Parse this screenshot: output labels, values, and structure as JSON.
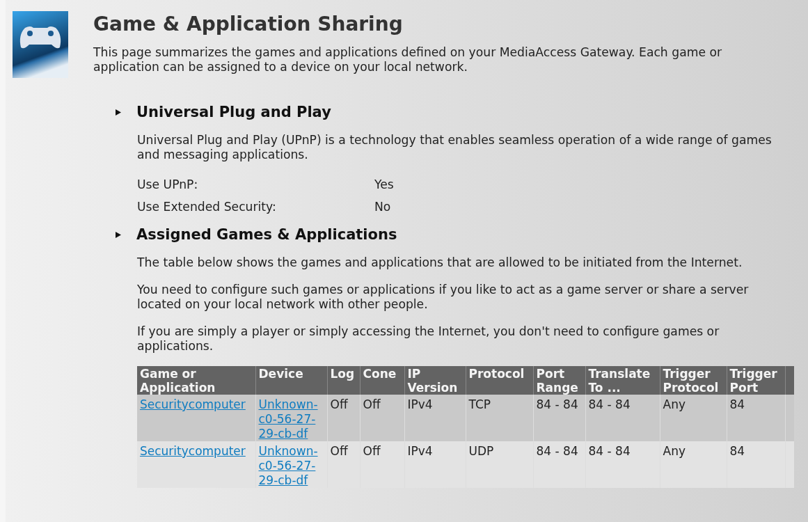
{
  "header": {
    "title": "Game & Application Sharing",
    "description": "This page summarizes the games and applications defined on your MediaAccess Gateway. Each game or application can be assigned to a device on your local network."
  },
  "sections": [
    {
      "title": "Universal Plug and Play",
      "paragraphs": [
        "Universal Plug and Play (UPnP) is a technology that enables seamless operation of a wide range of games and messaging applications."
      ],
      "settings": [
        {
          "label": "Use UPnP:",
          "value": "Yes"
        },
        {
          "label": "Use Extended Security:",
          "value": "No"
        }
      ]
    },
    {
      "title": "Assigned Games & Applications",
      "paragraphs": [
        "The table below shows the games and applications that are allowed to be initiated from the Internet.",
        "You need to configure such games or applications if you like to act as a game server or share a server located on your local network with other people.",
        "If you are simply a player or simply accessing the Internet, you don't need to configure games or applications."
      ],
      "table": {
        "columns": [
          "Game or Application",
          "Device",
          "Log",
          "Cone",
          "IP Version",
          "Protocol",
          "Port Range",
          "Translate To ...",
          "Trigger Protocol",
          "Trigger Port"
        ],
        "rows": [
          {
            "cells": [
              {
                "kind": "link",
                "text": "Securitycomputer"
              },
              {
                "kind": "link",
                "text": "Unknown-c0-56-27-29-cb-df"
              },
              {
                "kind": "text",
                "text": "Off"
              },
              {
                "kind": "text",
                "text": "Off"
              },
              {
                "kind": "text",
                "text": "IPv4"
              },
              {
                "kind": "text",
                "text": "TCP"
              },
              {
                "kind": "text",
                "text": "84 - 84"
              },
              {
                "kind": "text",
                "text": "84 - 84"
              },
              {
                "kind": "text",
                "text": "Any"
              },
              {
                "kind": "text",
                "text": "84"
              }
            ]
          },
          {
            "cells": [
              {
                "kind": "link",
                "text": "Securitycomputer"
              },
              {
                "kind": "link",
                "text": "Unknown-c0-56-27-29-cb-df"
              },
              {
                "kind": "text",
                "text": "Off"
              },
              {
                "kind": "text",
                "text": "Off"
              },
              {
                "kind": "text",
                "text": "IPv4"
              },
              {
                "kind": "text",
                "text": "UDP"
              },
              {
                "kind": "text",
                "text": "84 - 84"
              },
              {
                "kind": "text",
                "text": "84 - 84"
              },
              {
                "kind": "text",
                "text": "Any"
              },
              {
                "kind": "text",
                "text": "84"
              }
            ]
          }
        ]
      }
    }
  ]
}
